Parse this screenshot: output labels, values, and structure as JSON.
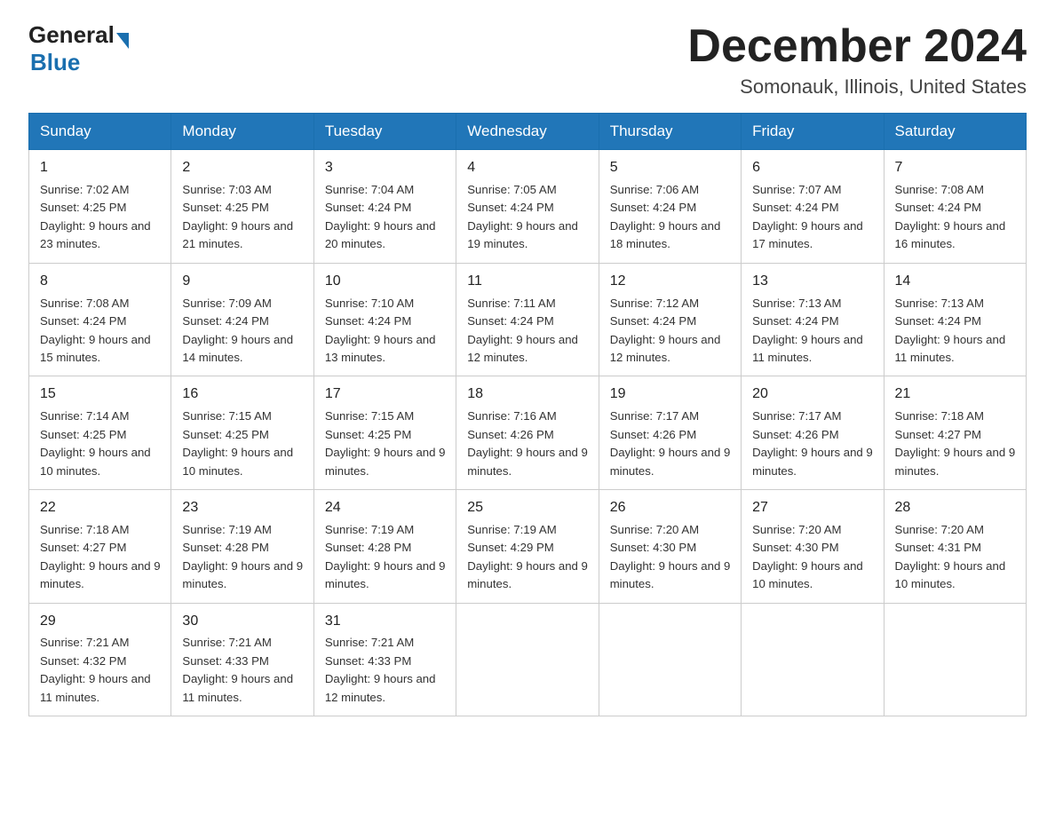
{
  "header": {
    "logo_general": "General",
    "logo_blue": "Blue",
    "month_title": "December 2024",
    "location": "Somonauk, Illinois, United States"
  },
  "weekdays": [
    "Sunday",
    "Monday",
    "Tuesday",
    "Wednesday",
    "Thursday",
    "Friday",
    "Saturday"
  ],
  "weeks": [
    [
      {
        "day": 1,
        "sunrise": "7:02 AM",
        "sunset": "4:25 PM",
        "daylight": "9 hours and 23 minutes."
      },
      {
        "day": 2,
        "sunrise": "7:03 AM",
        "sunset": "4:25 PM",
        "daylight": "9 hours and 21 minutes."
      },
      {
        "day": 3,
        "sunrise": "7:04 AM",
        "sunset": "4:24 PM",
        "daylight": "9 hours and 20 minutes."
      },
      {
        "day": 4,
        "sunrise": "7:05 AM",
        "sunset": "4:24 PM",
        "daylight": "9 hours and 19 minutes."
      },
      {
        "day": 5,
        "sunrise": "7:06 AM",
        "sunset": "4:24 PM",
        "daylight": "9 hours and 18 minutes."
      },
      {
        "day": 6,
        "sunrise": "7:07 AM",
        "sunset": "4:24 PM",
        "daylight": "9 hours and 17 minutes."
      },
      {
        "day": 7,
        "sunrise": "7:08 AM",
        "sunset": "4:24 PM",
        "daylight": "9 hours and 16 minutes."
      }
    ],
    [
      {
        "day": 8,
        "sunrise": "7:08 AM",
        "sunset": "4:24 PM",
        "daylight": "9 hours and 15 minutes."
      },
      {
        "day": 9,
        "sunrise": "7:09 AM",
        "sunset": "4:24 PM",
        "daylight": "9 hours and 14 minutes."
      },
      {
        "day": 10,
        "sunrise": "7:10 AM",
        "sunset": "4:24 PM",
        "daylight": "9 hours and 13 minutes."
      },
      {
        "day": 11,
        "sunrise": "7:11 AM",
        "sunset": "4:24 PM",
        "daylight": "9 hours and 12 minutes."
      },
      {
        "day": 12,
        "sunrise": "7:12 AM",
        "sunset": "4:24 PM",
        "daylight": "9 hours and 12 minutes."
      },
      {
        "day": 13,
        "sunrise": "7:13 AM",
        "sunset": "4:24 PM",
        "daylight": "9 hours and 11 minutes."
      },
      {
        "day": 14,
        "sunrise": "7:13 AM",
        "sunset": "4:24 PM",
        "daylight": "9 hours and 11 minutes."
      }
    ],
    [
      {
        "day": 15,
        "sunrise": "7:14 AM",
        "sunset": "4:25 PM",
        "daylight": "9 hours and 10 minutes."
      },
      {
        "day": 16,
        "sunrise": "7:15 AM",
        "sunset": "4:25 PM",
        "daylight": "9 hours and 10 minutes."
      },
      {
        "day": 17,
        "sunrise": "7:15 AM",
        "sunset": "4:25 PM",
        "daylight": "9 hours and 9 minutes."
      },
      {
        "day": 18,
        "sunrise": "7:16 AM",
        "sunset": "4:26 PM",
        "daylight": "9 hours and 9 minutes."
      },
      {
        "day": 19,
        "sunrise": "7:17 AM",
        "sunset": "4:26 PM",
        "daylight": "9 hours and 9 minutes."
      },
      {
        "day": 20,
        "sunrise": "7:17 AM",
        "sunset": "4:26 PM",
        "daylight": "9 hours and 9 minutes."
      },
      {
        "day": 21,
        "sunrise": "7:18 AM",
        "sunset": "4:27 PM",
        "daylight": "9 hours and 9 minutes."
      }
    ],
    [
      {
        "day": 22,
        "sunrise": "7:18 AM",
        "sunset": "4:27 PM",
        "daylight": "9 hours and 9 minutes."
      },
      {
        "day": 23,
        "sunrise": "7:19 AM",
        "sunset": "4:28 PM",
        "daylight": "9 hours and 9 minutes."
      },
      {
        "day": 24,
        "sunrise": "7:19 AM",
        "sunset": "4:28 PM",
        "daylight": "9 hours and 9 minutes."
      },
      {
        "day": 25,
        "sunrise": "7:19 AM",
        "sunset": "4:29 PM",
        "daylight": "9 hours and 9 minutes."
      },
      {
        "day": 26,
        "sunrise": "7:20 AM",
        "sunset": "4:30 PM",
        "daylight": "9 hours and 9 minutes."
      },
      {
        "day": 27,
        "sunrise": "7:20 AM",
        "sunset": "4:30 PM",
        "daylight": "9 hours and 10 minutes."
      },
      {
        "day": 28,
        "sunrise": "7:20 AM",
        "sunset": "4:31 PM",
        "daylight": "9 hours and 10 minutes."
      }
    ],
    [
      {
        "day": 29,
        "sunrise": "7:21 AM",
        "sunset": "4:32 PM",
        "daylight": "9 hours and 11 minutes."
      },
      {
        "day": 30,
        "sunrise": "7:21 AM",
        "sunset": "4:33 PM",
        "daylight": "9 hours and 11 minutes."
      },
      {
        "day": 31,
        "sunrise": "7:21 AM",
        "sunset": "4:33 PM",
        "daylight": "9 hours and 12 minutes."
      },
      null,
      null,
      null,
      null
    ]
  ]
}
